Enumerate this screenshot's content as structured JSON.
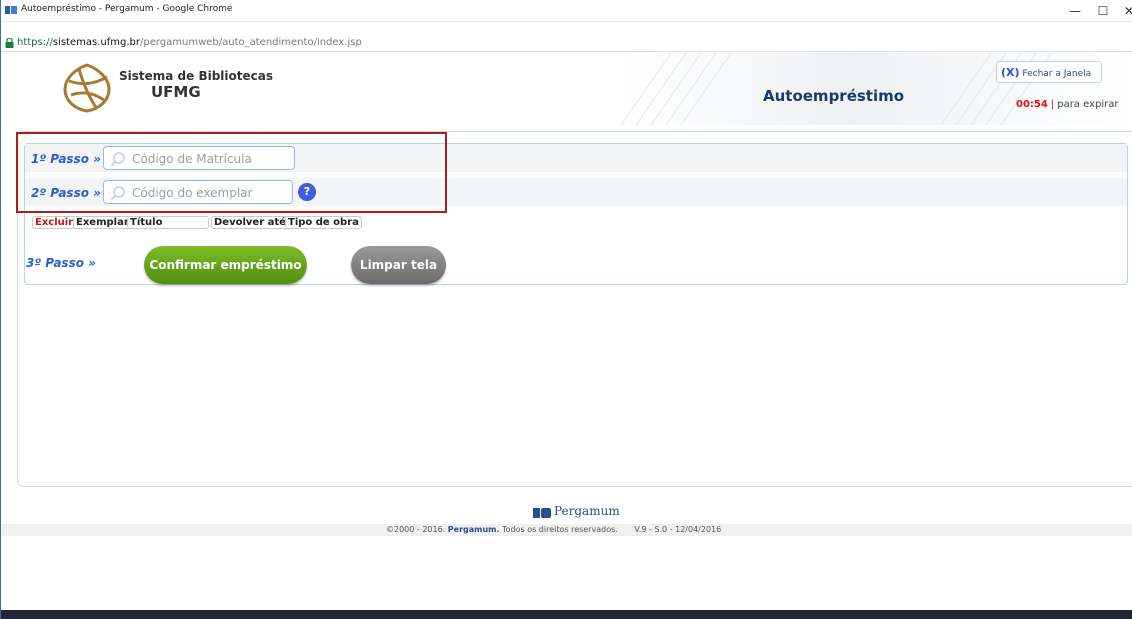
{
  "browser": {
    "title": "Autoempréstimo - Pergamum - Google Chrome",
    "url_scheme": "https://",
    "url_host": "sistemas.ufmg.br",
    "url_path": "/pergamumweb/auto_atendimento/index.jsp",
    "controls": {
      "minimize": "—",
      "maximize": "☐",
      "close": "✕"
    }
  },
  "header": {
    "logo_line1": "Sistema de Bibliotecas",
    "logo_line2": "UFMG",
    "page_title": "Autoempréstimo",
    "close_window": {
      "mark": "(X)",
      "label": "Fechar a Janela"
    },
    "timer": {
      "value": "00:54",
      "separator": "|",
      "label": "para expirar"
    }
  },
  "form": {
    "step1": {
      "label": "1º Passo »",
      "placeholder": "Código de Matrícula"
    },
    "step2": {
      "label": "2º Passo »",
      "placeholder": "Código do exemplar",
      "help": "?"
    },
    "step3": {
      "label": "3º Passo »"
    },
    "table_headers": [
      "Excluir",
      "Exemplar",
      "Título",
      "Devolver até",
      "Tipo de obra"
    ],
    "confirm_label": "Confirmar empréstimo",
    "clear_label": "Limpar tela"
  },
  "footer": {
    "brand": "Pergamum",
    "copyright_prefix": "©2000 - 2016.",
    "copyright_brand": "Pergamum.",
    "copyright_suffix": "Todos os direitos reservados.",
    "version": "V.9 - S.0 - 12/04/2016"
  },
  "colors": {
    "accent": "#2b5fc9",
    "confirm": "#5a9a14",
    "clear": "#7a7a7a",
    "highlight": "#b01c1c",
    "timer": "#dd1111"
  }
}
